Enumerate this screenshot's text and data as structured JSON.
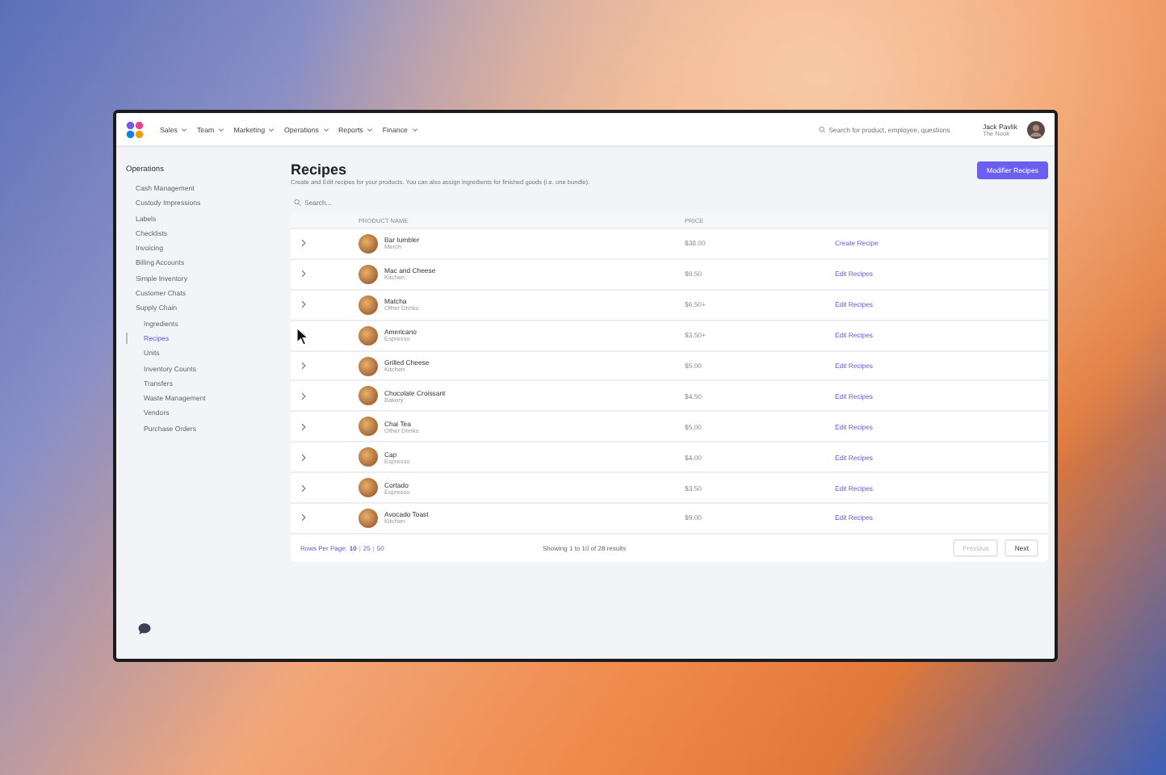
{
  "nav": {
    "items": [
      {
        "label": "Sales"
      },
      {
        "label": "Team"
      },
      {
        "label": "Marketing"
      },
      {
        "label": "Operations"
      },
      {
        "label": "Reports"
      },
      {
        "label": "Finance"
      }
    ],
    "search": {
      "placeholder": "Search for product, employee, questions"
    },
    "user": {
      "name": "Jack Pavlik",
      "org": "The Nook"
    }
  },
  "sidebar": {
    "heading": "Operations",
    "items": [
      {
        "label": "Cash Management",
        "selected": false
      },
      {
        "label": "Custody Impressions",
        "selected": false
      },
      {
        "label": "Labels",
        "selected": false
      },
      {
        "label": "Checklists",
        "selected": false
      },
      {
        "label": "Invoicing",
        "selected": false
      },
      {
        "label": "Billing Accounts",
        "selected": false
      },
      {
        "label": "Simple Inventory",
        "selected": false
      },
      {
        "label": "Customer Chats",
        "selected": false
      },
      {
        "label": "Supply Chain",
        "selected": false,
        "children": [
          {
            "label": "Ingredients",
            "selected": false
          },
          {
            "label": "Recipes",
            "selected": true
          },
          {
            "label": "Units",
            "selected": false
          },
          {
            "label": "Inventory Counts",
            "selected": false
          },
          {
            "label": "Transfers",
            "selected": false
          },
          {
            "label": "Waste Management",
            "selected": false
          },
          {
            "label": "Vendors",
            "selected": false
          },
          {
            "label": "Purchase Orders",
            "selected": false
          }
        ]
      }
    ]
  },
  "page": {
    "title": "Recipes",
    "subtitle": "Create and Edit recipes for your products. You can also assign ingredients for finished goods (i.e. one bundle).",
    "action": "Modifier Recipes",
    "search": {
      "placeholder": "Search..."
    }
  },
  "table": {
    "columns": [
      "PRODUCT NAME",
      "PRICE"
    ],
    "rows": [
      {
        "name": "Bar tumbler",
        "category": "Merch",
        "price": "$38.00",
        "action": "Create Recipe"
      },
      {
        "name": "Mac and Cheese",
        "category": "Kitchen",
        "price": "$9.50",
        "action": "Edit Recipes"
      },
      {
        "name": "Matcha",
        "category": "Other Drinks",
        "price": "$6.50+",
        "action": "Edit Recipes"
      },
      {
        "name": "Americano",
        "category": "Espresso",
        "price": "$3.50+",
        "action": "Edit Recipes"
      },
      {
        "name": "Grilled Cheese",
        "category": "Kitchen",
        "price": "$5.00",
        "action": "Edit Recipes"
      },
      {
        "name": "Chocolate Croissant",
        "category": "Bakery",
        "price": "$4.50",
        "action": "Edit Recipes"
      },
      {
        "name": "Chai Tea",
        "category": "Other Drinks",
        "price": "$5.00",
        "action": "Edit Recipes"
      },
      {
        "name": "Cap",
        "category": "Espresso",
        "price": "$4.00",
        "action": "Edit Recipes"
      },
      {
        "name": "Cortado",
        "category": "Espresso",
        "price": "$3.50",
        "action": "Edit Recipes"
      },
      {
        "name": "Avocado Toast",
        "category": "Kitchen",
        "price": "$9.00",
        "action": "Edit Recipes"
      }
    ]
  },
  "footer": {
    "rows_label": "Rows Per Page:",
    "separator": "|",
    "page_sizes": [
      {
        "label": "10",
        "selected": true
      },
      {
        "label": "25",
        "selected": false
      },
      {
        "label": "50",
        "selected": false
      }
    ],
    "summary": "Showing 1 to 10 of 28 results",
    "previous": {
      "label": "Previous",
      "disabled": true
    },
    "next": {
      "label": "Next",
      "disabled": false
    }
  }
}
